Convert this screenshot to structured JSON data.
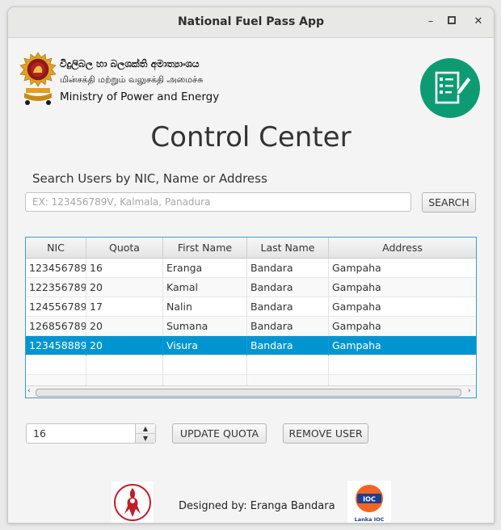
{
  "window": {
    "title": "National Fuel Pass App",
    "controls": {
      "minimize": "–",
      "maximize": "▢",
      "close": "✕"
    }
  },
  "header": {
    "ministry_sinhala": "විදුලිබල හා බලශක්ති අමාත්‍යාංශය",
    "ministry_tamil": "மின்சக்தி மற்றும் வலுசக்தி அமைச்சு",
    "ministry_english": "Ministry of Power and Energy",
    "app_icon": "checklist-edit-icon"
  },
  "main": {
    "heading": "Control Center",
    "search_label": "Search Users by NIC, Name or Address",
    "search_placeholder": "EX: 123456789V, Kalmala, Panadura",
    "search_value": "",
    "search_button": "SEARCH"
  },
  "table": {
    "columns": [
      "NIC",
      "Quota",
      "First Name",
      "Last Name",
      "Address"
    ],
    "rows": [
      [
        "123456789",
        "16",
        "Eranga",
        "Bandara",
        "Gampaha"
      ],
      [
        "122356789",
        "20",
        "Kamal",
        "Bandara",
        "Gampaha"
      ],
      [
        "124556789",
        "17",
        "Nalin",
        "Bandara",
        "Gampaha"
      ],
      [
        "126856789",
        "20",
        "Sumana",
        "Bandara",
        "Gampaha"
      ],
      [
        "123458889",
        "20",
        "Visura",
        "Bandara",
        "Gampaha"
      ]
    ],
    "selected_row": 4,
    "selection_color": "#0095d0"
  },
  "controls": {
    "quota_value": "16",
    "update_button": "UPDATE QUOTA",
    "remove_button": "REMOVE USER"
  },
  "footer": {
    "credit": "Designed by: Eranga Bandara",
    "logo2_top": "IOC",
    "logo2_bottom": "Lanka IOC"
  },
  "colors": {
    "accent_green": "#0d9b73",
    "selection_blue": "#0095d0",
    "table_border": "#3a9bd5",
    "ioc_orange": "#f26522",
    "ioc_blue": "#1c3f94",
    "emblem_gold": "#e0a020",
    "emblem_maroon": "#8b1a1a"
  }
}
